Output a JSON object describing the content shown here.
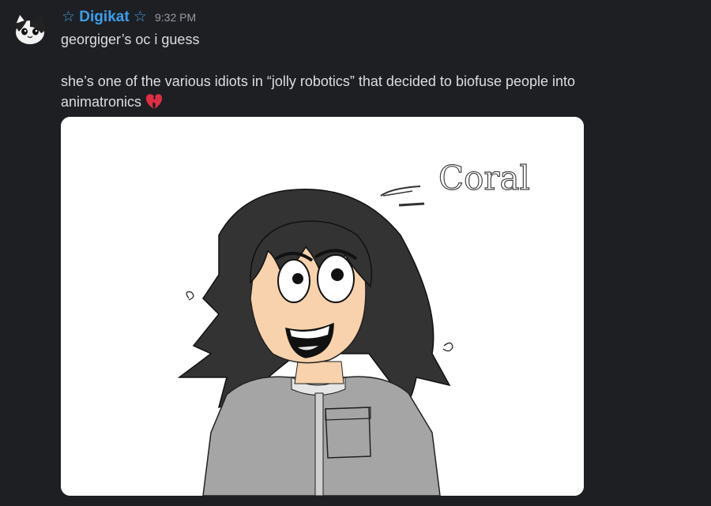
{
  "message": {
    "author": "☆ Digikat ☆",
    "timestamp": "9:32 PM",
    "lines": [
      "georgiger’s oc i guess",
      "she’s one of the various idiots in “jolly robotics” that decided to biofuse people into",
      "animatronics"
    ],
    "emoji": "broken-heart"
  },
  "attachment": {
    "handwritten_label": "Coral"
  },
  "colors": {
    "background": "#1e1f22",
    "username": "#3aa0ea",
    "timestamp": "#949ba4",
    "text": "#dbdee1"
  }
}
